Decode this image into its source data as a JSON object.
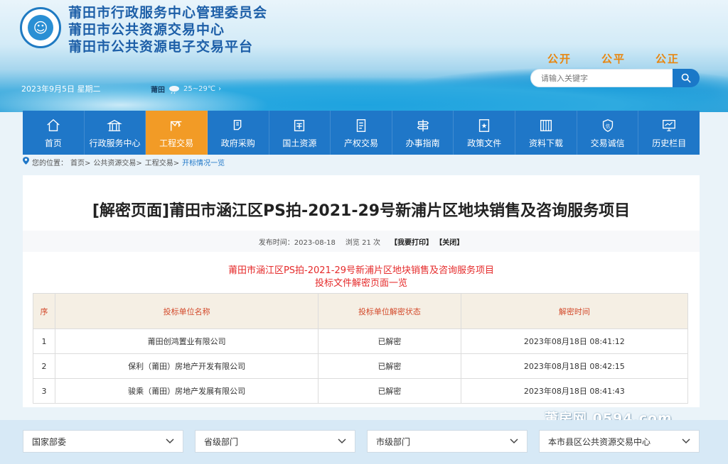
{
  "header": {
    "org_names": [
      "莆田市行政服务中心管理委员会",
      "莆田市公共资源交易中心",
      "莆田市公共资源电子交易平台"
    ],
    "logo_text": "☺",
    "slogans": [
      "公开",
      "公平",
      "公正"
    ],
    "search": {
      "placeholder": "请输入关键字"
    },
    "date": "2023年9月5日 星期二",
    "weather": {
      "city": "莆田",
      "icon": "cloud-rain-icon",
      "temp": "25~29℃",
      "more": "›"
    }
  },
  "nav": {
    "items": [
      {
        "label": "首页",
        "icon": "home-icon"
      },
      {
        "label": "行政服务中心",
        "icon": "building-icon"
      },
      {
        "label": "工程交易",
        "icon": "construction-icon",
        "active": true
      },
      {
        "label": "政府采购",
        "icon": "cart-icon"
      },
      {
        "label": "国土资源",
        "icon": "land-icon"
      },
      {
        "label": "产权交易",
        "icon": "property-icon"
      },
      {
        "label": "办事指南",
        "icon": "signpost-icon"
      },
      {
        "label": "政策文件",
        "icon": "document-icon"
      },
      {
        "label": "资料下载",
        "icon": "download-icon"
      },
      {
        "label": "交易诚信",
        "icon": "shield-icon"
      },
      {
        "label": "历史栏目",
        "icon": "monitor-icon"
      }
    ]
  },
  "breadcrumb": {
    "prefix": "您的位置：",
    "items": [
      "首页>",
      "公共资源交易>",
      "工程交易>"
    ],
    "current": "开标情况一览"
  },
  "article": {
    "title": "[解密页面]莆田市涵江区PS拍-2021-29号新浦片区地块销售及咨询服务项目",
    "publish_time": "发布时间：2023-08-18",
    "views": "浏览 21 次",
    "print_label": "【我要打印】",
    "close_label": "【关闭】",
    "sub_title_1": "莆田市涵江区PS拍-2021-29号新浦片区地块销售及咨询服务项目",
    "sub_title_2": "投标文件解密页面一览"
  },
  "table": {
    "headers": [
      "序",
      "投标单位名称",
      "投标单位解密状态",
      "解密时间"
    ],
    "rows": [
      [
        "1",
        "莆田创鸿置业有限公司",
        "已解密",
        "2023年08月18日 08:41:12"
      ],
      [
        "2",
        "保利（莆田）房地产开发有限公司",
        "已解密",
        "2023年08月18日 08:42:15"
      ],
      [
        "3",
        "骏乘（莆田）房地产发展有限公司",
        "已解密",
        "2023年08月18日 08:41:43"
      ]
    ]
  },
  "watermark": "莆房网 0594.com",
  "footer": {
    "selects": [
      "国家部委",
      "省级部门",
      "市级部门",
      "本市县区公共资源交易中心"
    ]
  },
  "colors": {
    "nav": "#1f77c8",
    "active": "#f29b26",
    "accent_red": "#e52a2a",
    "slogan": "#e8860f"
  }
}
